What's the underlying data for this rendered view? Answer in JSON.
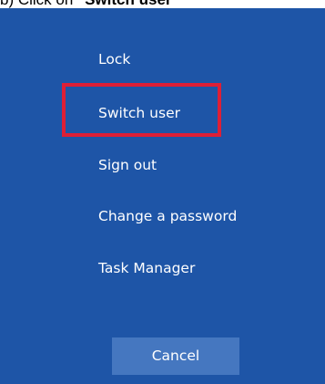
{
  "instruction": {
    "prefix": "b) Click on ",
    "emphasis": "\"Switch user\""
  },
  "menu": {
    "items": [
      {
        "label": "Lock"
      },
      {
        "label": "Switch user"
      },
      {
        "label": "Sign out"
      },
      {
        "label": "Change a password"
      },
      {
        "label": "Task Manager"
      }
    ]
  },
  "cancel_button": {
    "label": "Cancel"
  },
  "colors": {
    "background": "#1e55a7",
    "highlight": "#de1f36",
    "button": "#4577c0",
    "text": "#ffffff"
  }
}
